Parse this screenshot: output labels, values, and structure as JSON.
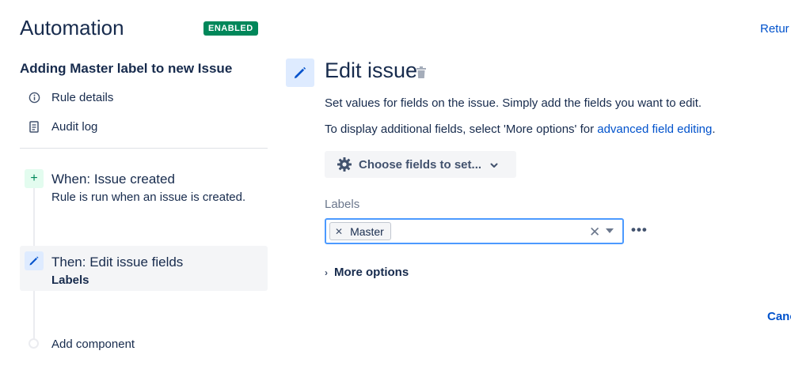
{
  "header": {
    "title": "Automation",
    "status_badge": "ENABLED",
    "return_link": "Retur"
  },
  "sidebar": {
    "rule_name": "Adding Master label to new Issue",
    "links": [
      {
        "label": "Rule details",
        "icon": "info-icon"
      },
      {
        "label": "Audit log",
        "icon": "document-icon"
      }
    ],
    "trigger": {
      "title": "When: Issue created",
      "subtitle": "Rule is run when an issue is created.",
      "icon": "plus-icon"
    },
    "action": {
      "title": "Then: Edit issue fields",
      "subtitle": "Labels",
      "icon": "pencil-icon"
    },
    "add_component": "Add component"
  },
  "main": {
    "title": "Edit issue",
    "description": "Set values for fields on the issue. Simply add the fields you want to edit.",
    "info_prefix": "To display additional fields, select 'More options' for ",
    "info_link": "advanced field editing",
    "info_suffix": ".",
    "choose_fields_button": "Choose fields to set...",
    "labels_field": {
      "label": "Labels",
      "tags": [
        "Master"
      ]
    },
    "more_options": "More options",
    "cancel": "Canc"
  },
  "colors": {
    "enabled_green": "#00875a",
    "link_blue": "#0052cc",
    "focus_border": "#4c9aff",
    "text_dark": "#172b4d"
  }
}
